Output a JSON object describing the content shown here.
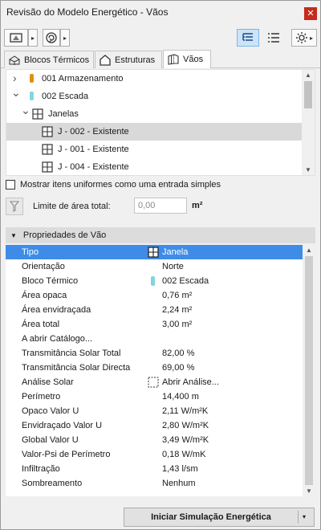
{
  "window": {
    "title": "Revisão do Modelo Energético - Vãos",
    "close_glyph": "✕"
  },
  "toolbar": {
    "dropdown_glyph": "▸"
  },
  "tabs": [
    {
      "label": "Blocos Térmicos",
      "icon": "thermal-block-icon"
    },
    {
      "label": "Estruturas",
      "icon": "house-icon"
    },
    {
      "label": "Vãos",
      "icon": "opening-icon",
      "active": true
    }
  ],
  "tree": {
    "items": [
      {
        "label": "001 Armazenamento",
        "expander": "›",
        "color": "#e0900e"
      },
      {
        "label": "002 Escada",
        "expander": "⌄",
        "color": "#7fd7e0"
      },
      {
        "label": "Janelas",
        "expander": "⌄"
      },
      {
        "label": "J - 002 - Existente",
        "selected": true
      },
      {
        "label": "J - 001 - Existente"
      },
      {
        "label": "J - 004 - Existente"
      }
    ]
  },
  "options": {
    "uniform_label": "Mostrar itens uniformes como uma entrada simples",
    "area_label": "Limite de área total:",
    "area_value": "0,00",
    "area_unit": "m²"
  },
  "properties": {
    "header": "Propriedades de Vão",
    "rows": [
      {
        "name": "Tipo",
        "value": "Janela",
        "icon": "window-icon",
        "selected": true
      },
      {
        "name": "Orientação",
        "value": "Norte"
      },
      {
        "name": "Bloco Térmico",
        "value": "002 Escada",
        "swatch": "#7fd7e0"
      },
      {
        "name": "Área opaca",
        "value": "0,76 m²"
      },
      {
        "name": "Área envidraçada",
        "value": "2,24 m²"
      },
      {
        "name": "Área total",
        "value": "3,00 m²"
      },
      {
        "name": "A abrir Catálogo...",
        "value": ""
      },
      {
        "name": "Transmitância Solar Total",
        "value": "82,00 %"
      },
      {
        "name": "Transmitância Solar Directa",
        "value": "69,00 %"
      },
      {
        "name": "Análise Solar",
        "value": "Abrir Análise...",
        "icon": "dashed-box-icon"
      },
      {
        "name": "Perímetro",
        "value": "14,400 m"
      },
      {
        "name": "Opaco Valor U",
        "value": "2,11 W/m²K"
      },
      {
        "name": "Envidraçado Valor U",
        "value": "2,80 W/m²K"
      },
      {
        "name": "Global Valor U",
        "value": "3,49 W/m²K"
      },
      {
        "name": "Valor-Psi de Perímetro",
        "value": "0,18 W/mK"
      },
      {
        "name": "Infiltração",
        "value": "1,43 l/sm"
      },
      {
        "name": "Sombreamento",
        "value": "Nenhum"
      }
    ]
  },
  "footer": {
    "simulate_label": "Iniciar Simulação Energética",
    "dropdown_glyph": "▾"
  },
  "colors": {
    "selection": "#3f8ce8",
    "tree_selection": "#d9d9d9",
    "close": "#c42b1c"
  }
}
